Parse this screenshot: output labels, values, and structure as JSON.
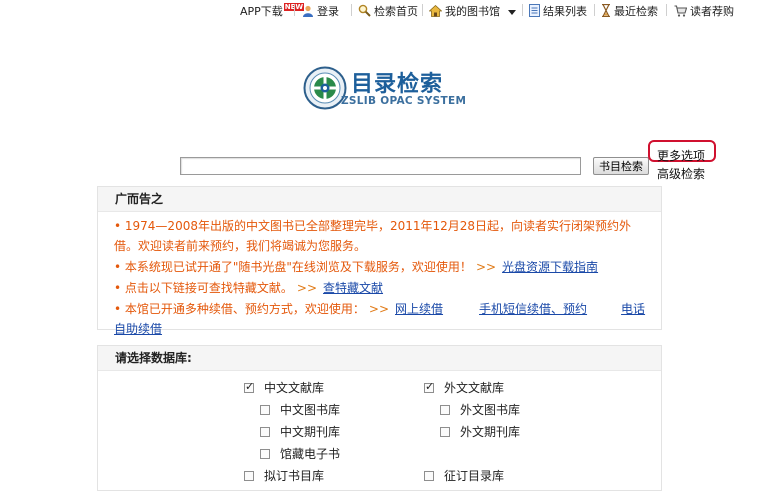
{
  "nav": {
    "app_download": "APP下载",
    "new_badge": "NEW",
    "login": "登录",
    "search_home": "检索首页",
    "my_library": "我的图书馆",
    "result_list": "结果列表",
    "recent_search": "最近检索",
    "reader_recommend": "读者荐购"
  },
  "logo": {
    "title": "目录检索",
    "subtitle": "ZSLIB OPAC SYSTEM"
  },
  "search": {
    "value": "",
    "button_label": "书目检索",
    "more_options": "更多选项",
    "advanced": "高级检索"
  },
  "announcement": {
    "title": "广而告之",
    "items": {
      "0": {
        "text": "• 1974—2008年出版的中文图书已全部整理完毕，2011年12月28日起，向读者实行闭架预约外借。欢迎读者前来预约，我们将竭诚为您服务。"
      },
      "1": {
        "text": "• 本系统现已试开通了\"随书光盘\"在线浏览及下载服务，欢迎使用！",
        "arrow": ">>",
        "link": "光盘资源下载指南"
      },
      "2": {
        "text": "• 点击以下链接可查找特藏文献。",
        "arrow": ">>",
        "link": "查特藏文献"
      },
      "3": {
        "text": "• 本馆已开通多种续借、预约方式，欢迎使用：",
        "arrow": ">>",
        "link1": "网上续借",
        "link2": "手机短信续借、预约",
        "link3": "电话自助续借"
      }
    }
  },
  "databases": {
    "title": "请选择数据库:",
    "chinese": {
      "label": "中文文献库",
      "checked": true
    },
    "chinese_books": {
      "label": "中文图书库",
      "checked": false
    },
    "chinese_journals": {
      "label": "中文期刊库",
      "checked": false
    },
    "ebooks": {
      "label": "馆藏电子书",
      "checked": false
    },
    "foreign": {
      "label": "外文文献库",
      "checked": true
    },
    "foreign_books": {
      "label": "外文图书库",
      "checked": false
    },
    "foreign_journals": {
      "label": "外文期刊库",
      "checked": false
    },
    "to_order": {
      "label": "拟订书目库",
      "checked": false
    },
    "solicit": {
      "label": "征订目录库",
      "checked": false
    }
  },
  "colors": {
    "accent_blue": "#1d5f9b",
    "notice_orange": "#e4580b",
    "link_blue": "#1a49a8",
    "highlight_red": "#d0102f"
  }
}
